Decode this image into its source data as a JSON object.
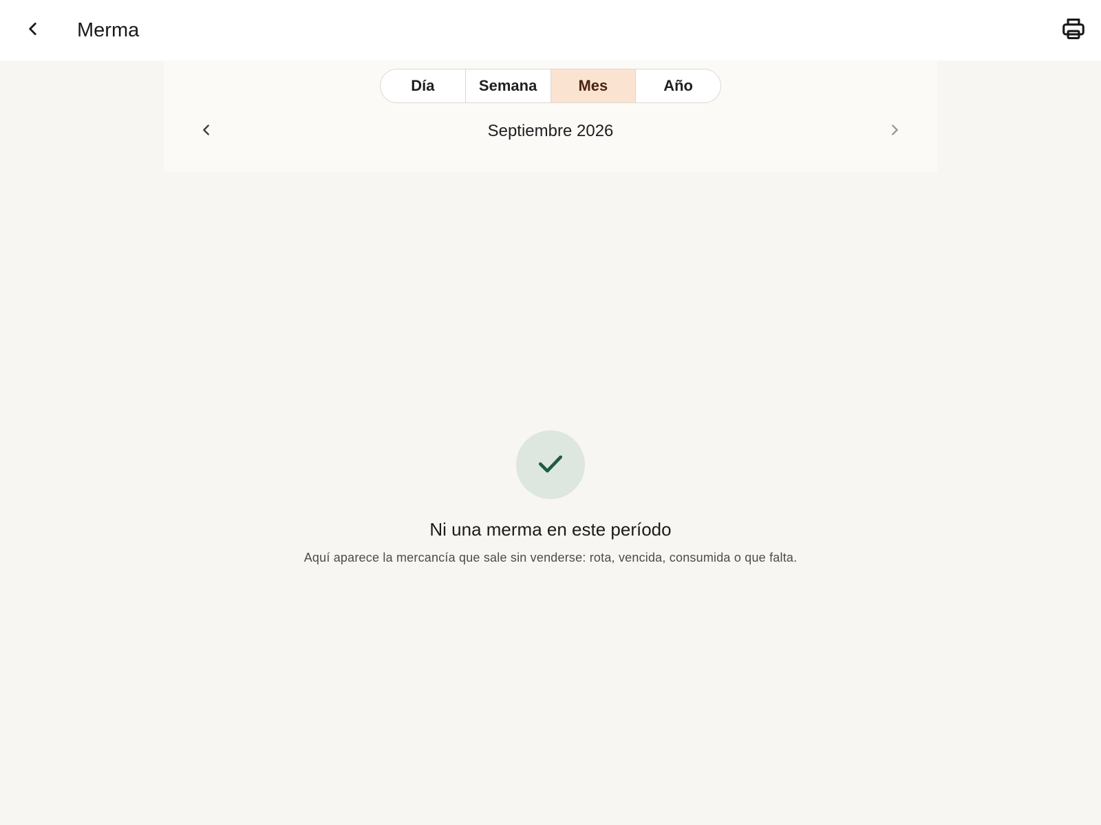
{
  "app_bar": {
    "title": "Merma",
    "back_icon": "chevron-left-icon",
    "print_icon": "printer-icon"
  },
  "period_selector": {
    "tabs": [
      {
        "label": "Día",
        "active": false
      },
      {
        "label": "Semana",
        "active": false
      },
      {
        "label": "Mes",
        "active": true
      },
      {
        "label": "Año",
        "active": false
      }
    ],
    "current_period": "Septiembre 2026",
    "prev_icon": "chevron-left-icon",
    "next_icon": "chevron-right-icon"
  },
  "empty_state": {
    "icon": "checkmark-icon",
    "title": "Ni una merma en este período",
    "subtitle": "Aquí aparece la mercancía que sale sin venderse: rota, vencida, consumida o que falta."
  },
  "colors": {
    "background": "#f8f6f2",
    "app_bar": "#ffffff",
    "active_tab": "#fbe3d2",
    "check_circle": "#dde6df",
    "check_mark": "#1f5b43"
  }
}
